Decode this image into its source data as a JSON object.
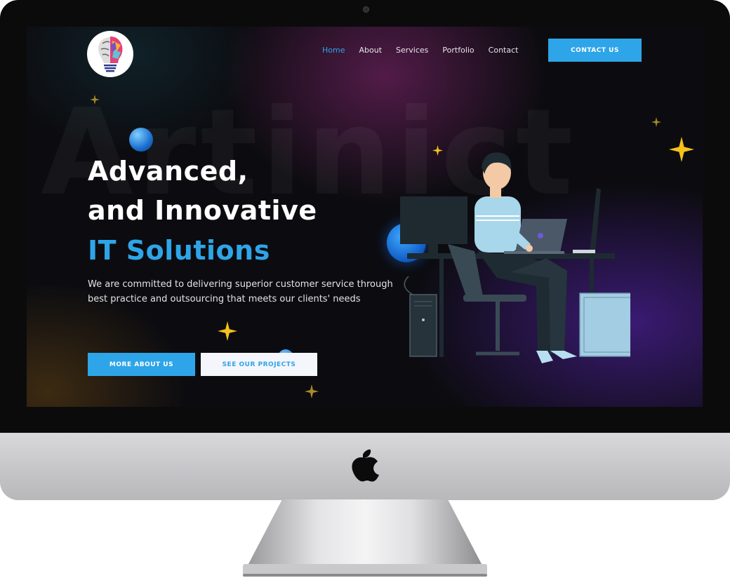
{
  "nav": {
    "items": [
      {
        "label": "Home",
        "active": true
      },
      {
        "label": "About",
        "active": false
      },
      {
        "label": "Services",
        "active": false
      },
      {
        "label": "Portfolio",
        "active": false
      },
      {
        "label": "Contact",
        "active": false
      }
    ],
    "contact_button": "CONTACT US"
  },
  "hero": {
    "watermark": "Artinict",
    "headline_line1": "Advanced,",
    "headline_line2": "and Innovative",
    "headline_line3": "IT Solutions",
    "subtitle": "We are committed to delivering superior customer service through best practice and outsourcing that meets our clients' needs",
    "primary_button": "MORE ABOUT US",
    "secondary_button": "SEE OUR PROJECTS"
  },
  "colors": {
    "accent": "#2ea5e8",
    "star": "#f6c21a",
    "background": "#0c0c10"
  },
  "icons": [
    "apple-logo-icon",
    "brain-bulb-logo-icon",
    "sparkle-star-icon"
  ]
}
